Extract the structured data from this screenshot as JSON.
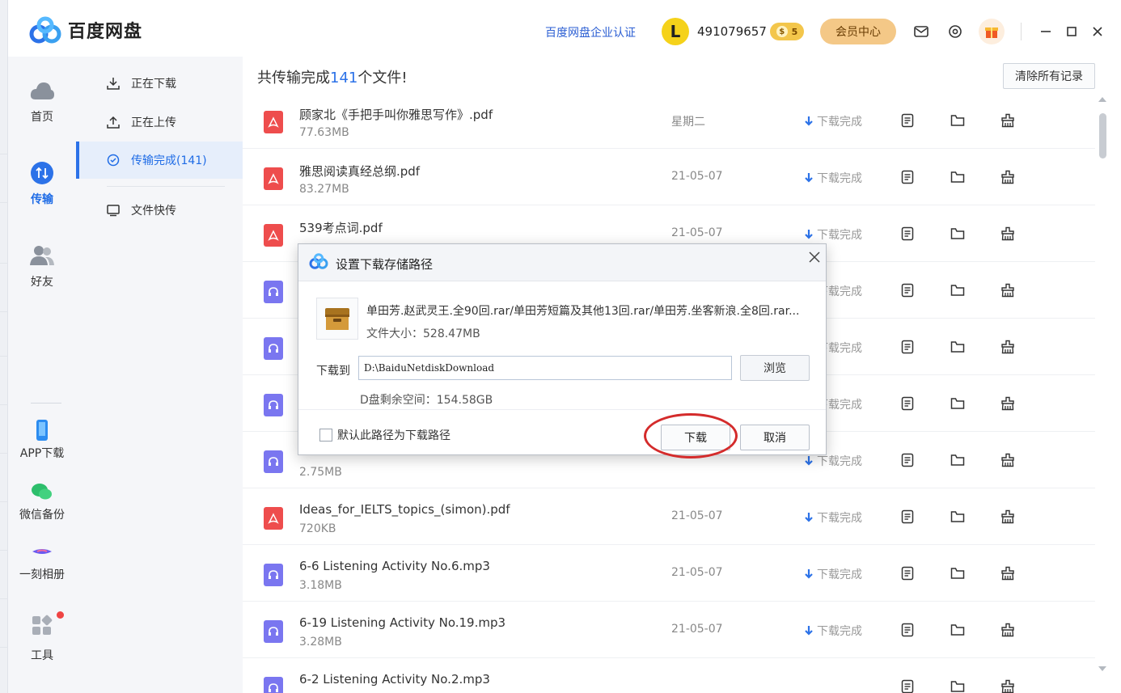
{
  "app": {
    "name": "百度网盘"
  },
  "header": {
    "enterprise_link": "百度网盘企业认证",
    "avatar_letter": "L",
    "user_id": "491079657",
    "vip_badge": "5",
    "member_button": "会员中心"
  },
  "leftnav": {
    "items": [
      {
        "label": "首页",
        "icon": "cloud-icon"
      },
      {
        "label": "传输",
        "icon": "transfer-icon"
      },
      {
        "label": "好友",
        "icon": "friends-icon"
      },
      {
        "label": "APP下载",
        "icon": "phone-icon"
      },
      {
        "label": "微信备份",
        "icon": "wechat-icon"
      },
      {
        "label": "一刻相册",
        "icon": "album-icon"
      },
      {
        "label": "工具",
        "icon": "tools-icon"
      }
    ]
  },
  "subnav": {
    "items": [
      {
        "label": "正在下载"
      },
      {
        "label": "正在上传"
      },
      {
        "label": "传输完成(141)"
      },
      {
        "label": "文件快传"
      }
    ]
  },
  "main": {
    "summary_prefix": "共传输完成",
    "summary_count": "141",
    "summary_suffix": "个文件!",
    "clear_button": "清除所有记录",
    "files": [
      {
        "name": "顾家北《手把手叫你雅思写作》.pdf",
        "size": "77.63MB",
        "date": "星期二",
        "status": "下载完成",
        "type": "pdf"
      },
      {
        "name": "雅思阅读真经总纲.pdf",
        "size": "83.27MB",
        "date": "21-05-07",
        "status": "下载完成",
        "type": "pdf"
      },
      {
        "name": "539考点词.pdf",
        "size": "",
        "date": "21-05-07",
        "status": "下载完成",
        "type": "pdf"
      },
      {
        "name": "",
        "size": "",
        "date": "",
        "status": "下载完成",
        "type": "mp3"
      },
      {
        "name": "",
        "size": "",
        "date": "",
        "status": "下载完成",
        "type": "mp3"
      },
      {
        "name": "",
        "size": "",
        "date": "",
        "status": "下载完成",
        "type": "mp3"
      },
      {
        "name": "",
        "size": "2.75MB",
        "date": "",
        "status": "下载完成",
        "type": "mp3"
      },
      {
        "name": "Ideas_for_IELTS_topics_(simon).pdf",
        "size": "720KB",
        "date": "21-05-07",
        "status": "下载完成",
        "type": "pdf"
      },
      {
        "name": "6-6 Listening Activity No.6.mp3",
        "size": "3.18MB",
        "date": "21-05-07",
        "status": "下载完成",
        "type": "mp3"
      },
      {
        "name": "6-19 Listening Activity No.19.mp3",
        "size": "3.28MB",
        "date": "21-05-07",
        "status": "下载完成",
        "type": "mp3"
      },
      {
        "name": "6-2 Listening Activity No.2.mp3",
        "size": "",
        "date": "",
        "status": "",
        "type": "mp3"
      }
    ]
  },
  "dialog": {
    "title": "设置下载存储路径",
    "file_name": "单田芳.赵武灵王.全90回.rar/单田芳短篇及其他13回.rar/单田芳.坐客新浪.全8回.rar...",
    "file_size_label": "文件大小：528.47MB",
    "download_to_label": "下载到",
    "path_value": "D:\\BaiduNetdiskDownload",
    "browse_button": "浏览",
    "free_space": "D盘剩余空间：154.58GB",
    "default_checkbox_label": "默认此路径为下载路径",
    "default_checked": false,
    "download_button": "下载",
    "cancel_button": "取消"
  },
  "colors": {
    "accent": "#2c72e8",
    "pdf": "#ee4d4d",
    "audio": "#7a76f0",
    "member": "#f4c887",
    "highlight": "#d42b2b"
  }
}
